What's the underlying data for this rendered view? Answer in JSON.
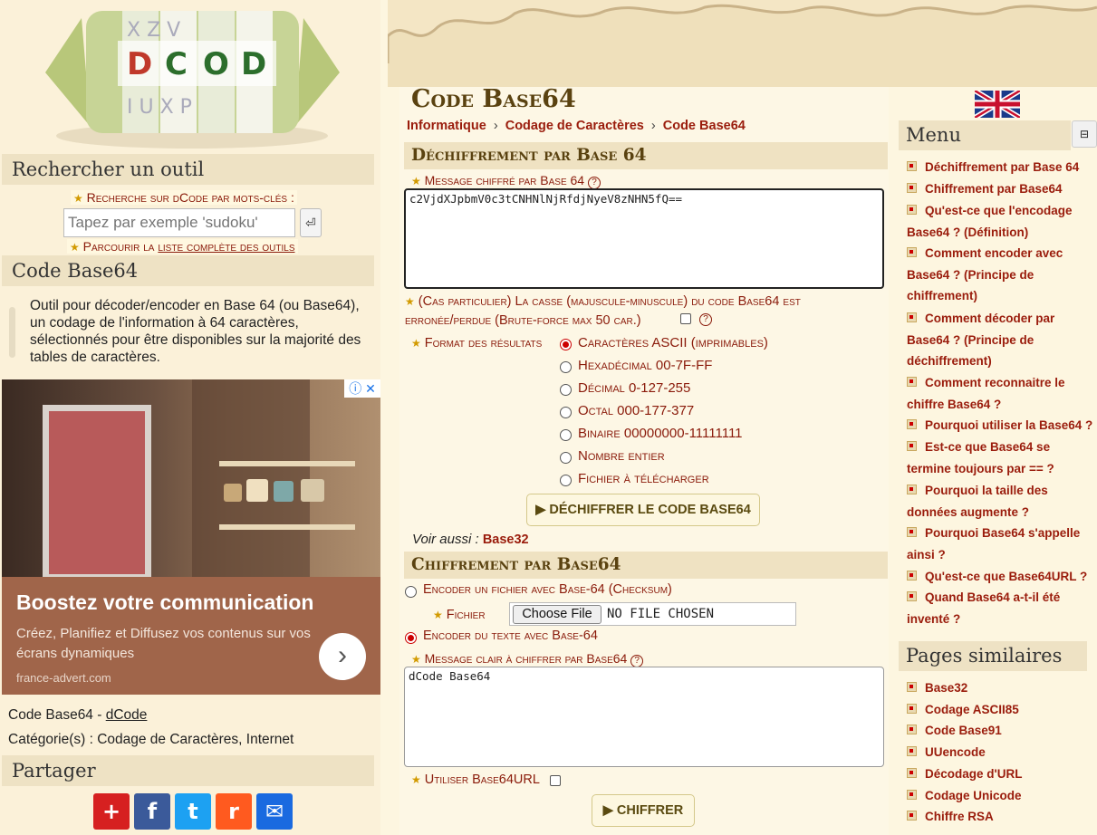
{
  "sidebar": {
    "logo_letters": "DCODE",
    "search_heading": "Rechercher un outil",
    "search_label": "Recherche sur dCode par mots-clés :",
    "search_placeholder": "Tapez par exemple 'sudoku'",
    "search_button": "⏎",
    "browse_prefix": "Parcourir la",
    "browse_link": "liste complète des outils",
    "tool_heading": "Code Base64",
    "tool_description": "Outil pour décoder/encoder en Base 64 (ou Base64), un codage de l'information à 64 caractères, sélectionnés pour être disponibles sur la majorité des tables de caractères.",
    "ad": {
      "title": "Boostez votre communication",
      "text": "Créez, Planifiez et Diffusez vos contenus sur vos écrans dynamiques",
      "url": "france-advert.com",
      "arrow": "›",
      "info": "ⓘ ✕"
    },
    "page_prefix": "Code Base64 - ",
    "page_link": "dCode",
    "category_line": "Catégorie(s) : Codage de Caractères, Internet",
    "share_heading": "Partager",
    "share_icons": [
      "+",
      "f",
      "t",
      "r",
      "✉"
    ]
  },
  "main": {
    "title": "Code Base64",
    "breadcrumb": [
      "Informatique",
      "Codage de Caractères",
      "Code Base64"
    ],
    "breadcrumb_sep": "›",
    "decode": {
      "heading": "Déchiffrement par Base 64",
      "message_label": "Message chiffré par Base 64",
      "message_value": "c2VjdXJpbmV0c3tCNHNlNjRfdjNyeV8zNHN5fQ==",
      "case_label": "(Cas particulier) La casse (majuscule-minuscule) du code Base64 est erronée/perdue (Brute-force max 50 car.)",
      "format_label": "Format des résultats",
      "formats": [
        "Caractères ASCII (imprimables)",
        "Hexadécimal 00-7F-FF",
        "Décimal 0-127-255",
        "Octal 000-177-377",
        "Binaire 00000000-11111111",
        "Nombre entier",
        "Fichier à télécharger"
      ],
      "button": "▶ DÉCHIFFRER LE CODE BASE64",
      "see_also_label": "Voir aussi :",
      "see_also_link": "Base32"
    },
    "encode": {
      "heading": "Chiffrement par Base64",
      "file_option": "Encoder un fichier avec Base-64 (Checksum)",
      "file_label": "Fichier",
      "file_button": "Choose File",
      "file_status": "NO FILE CHOSEN",
      "text_option": "Encoder du texte avec Base-64",
      "message_label": "Message clair à chiffrer par Base64",
      "message_value": "dCode Base64",
      "url_option": "Utiliser Base64URL",
      "button": "▶ CHIFFRER"
    }
  },
  "right": {
    "menu_heading": "Menu",
    "collapse": "⊟",
    "menu_items": [
      "Déchiffrement par Base 64",
      "Chiffrement par Base64",
      "Qu'est-ce que l'encodage Base64 ? (Définition)",
      "Comment encoder avec Base64 ? (Principe de chiffrement)",
      "Comment décoder par Base64 ? (Principe de déchiffrement)",
      "Comment reconnaitre le chiffre Base64 ?",
      "Pourquoi utiliser la Base64 ?",
      "Est-ce que Base64 se termine toujours par == ?",
      "Pourquoi la taille des données augmente ?",
      "Pourquoi Base64 s'appelle ainsi ?",
      "Qu'est-ce que Base64URL ?",
      "Quand Base64 a-t-il été inventé ?"
    ],
    "similar_heading": "Pages similaires",
    "similar_items": [
      "Base32",
      "Codage ASCII85",
      "Code Base91",
      "UUencode",
      "Décodage d'URL",
      "Codage Unicode",
      "Chiffre RSA"
    ]
  }
}
